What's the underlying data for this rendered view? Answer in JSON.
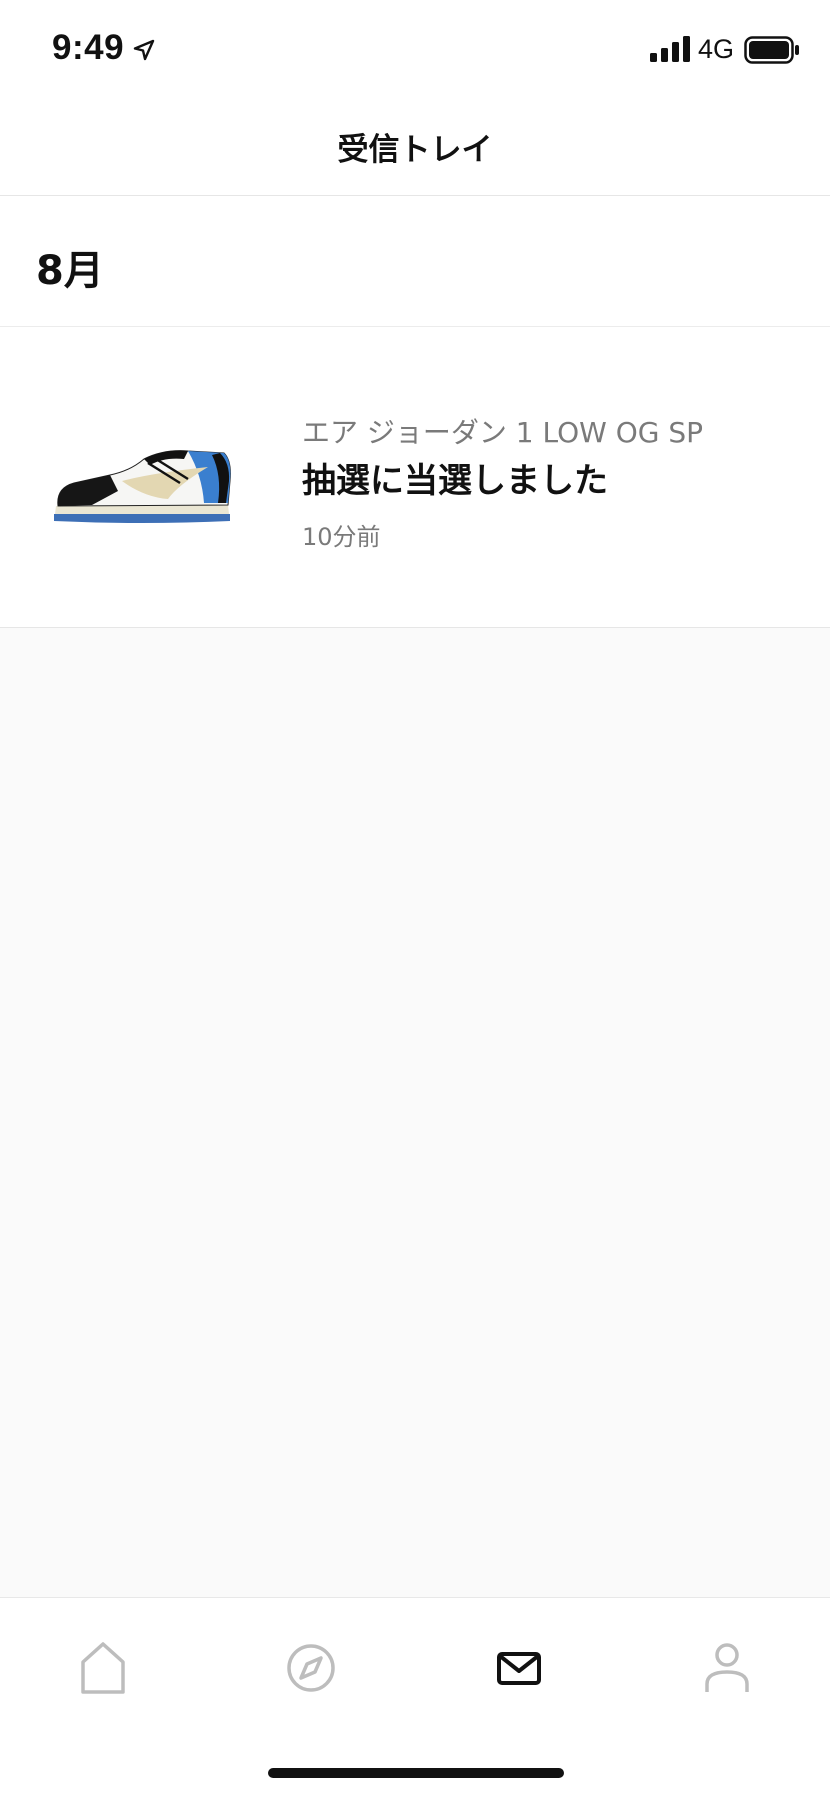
{
  "status_bar": {
    "time": "9:49",
    "network": "4G",
    "icons": [
      "location-arrow-icon",
      "signal-icon",
      "battery-icon"
    ]
  },
  "header": {
    "title": "受信トレイ"
  },
  "section": {
    "title": "8月"
  },
  "inbox_items": [
    {
      "product": "エア ジョーダン 1 LOW OG SP",
      "message": "抽選に当選しました",
      "time": "10分前",
      "thumbnail": "sneaker-thumbnail"
    }
  ],
  "tab_bar": {
    "tabs": [
      {
        "name": "home",
        "icon": "home-icon",
        "active": false
      },
      {
        "name": "discover",
        "icon": "compass-icon",
        "active": false
      },
      {
        "name": "inbox",
        "icon": "envelope-icon",
        "active": true
      },
      {
        "name": "profile",
        "icon": "person-icon",
        "active": false
      }
    ]
  },
  "colors": {
    "active_icon": "#111111",
    "inactive_icon": "#bdbdbd",
    "secondary_text": "#7a7a7a",
    "page_background": "#fafafa"
  }
}
